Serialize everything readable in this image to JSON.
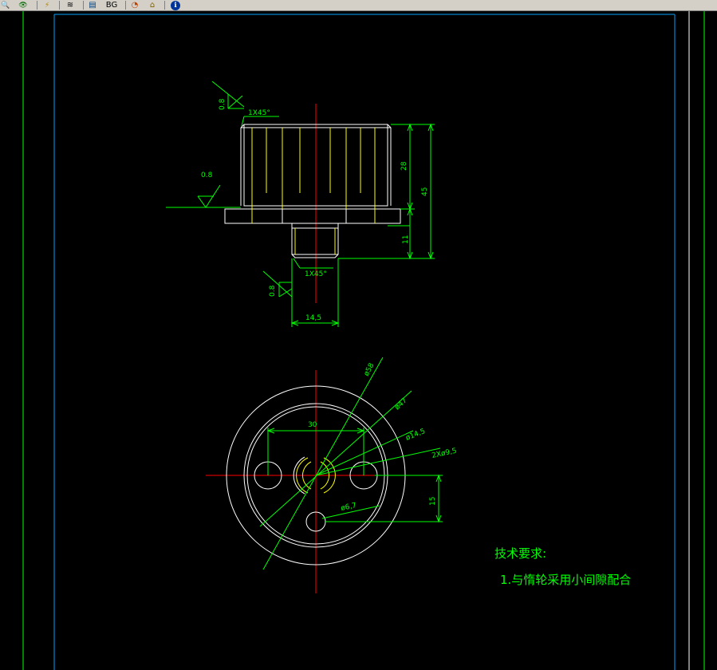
{
  "toolbar": {
    "buttons": [
      {
        "name": "zoom-icon",
        "glyph": "🔍"
      },
      {
        "name": "view-eye-icon",
        "glyph": "👁"
      },
      {
        "name": "lightning-icon",
        "glyph": "⚡"
      },
      {
        "name": "layers-icon",
        "glyph": "≋"
      },
      {
        "name": "sheet-icon",
        "glyph": "▤"
      },
      {
        "name": "bg-button",
        "label": "BG"
      },
      {
        "name": "color-wheel-icon",
        "glyph": "◔"
      },
      {
        "name": "home-icon",
        "glyph": "⌂"
      },
      {
        "name": "info-icon",
        "glyph": "ℹ"
      }
    ]
  },
  "drawing": {
    "colors": {
      "background": "#000000",
      "outline": "#ffffff",
      "dimension": "#00ff00",
      "centerline": "#ff0000",
      "hidden": "#ffff00",
      "frame": "#00a0ff"
    },
    "side_view": {
      "roughness_top": "0.8",
      "chamfer_top": "1X45°",
      "roughness_left": "0.8",
      "dim_28": "28",
      "dim_45": "45",
      "dim_11": "11",
      "chamfer_bottom": "1X45°",
      "roughness_bottom": "0.8",
      "dim_shaft": "14,5"
    },
    "top_view": {
      "dia_58": "ø58",
      "dia_47": "ø47",
      "dia_14_5": "ø14,5",
      "holes_9_5": "2Xø9,5",
      "dim_30": "30",
      "dim_15": "15",
      "dia_6_7": "ø6,7"
    },
    "notes": {
      "heading": "技术要求:",
      "item_1": "1.与惰轮采用小间隙配合"
    }
  }
}
